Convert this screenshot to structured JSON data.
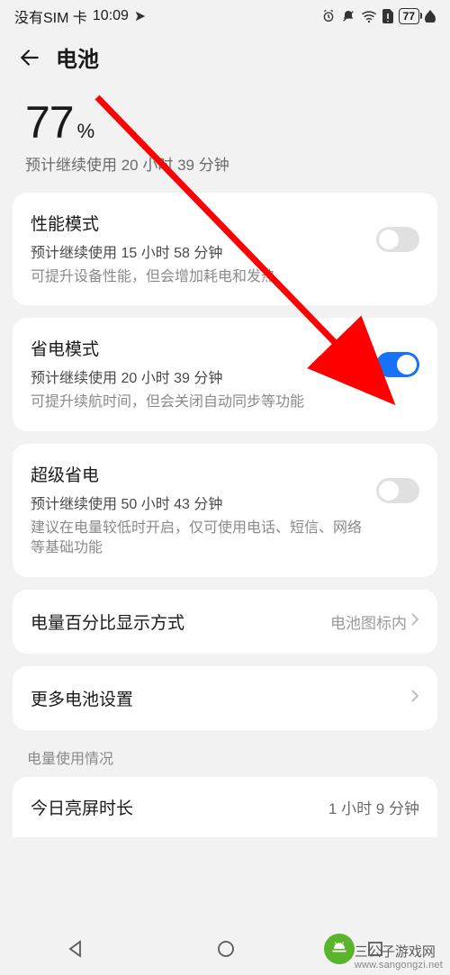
{
  "status_bar": {
    "sim": "没有SIM 卡",
    "time": "10:09",
    "battery": "77"
  },
  "header": {
    "title": "电池"
  },
  "battery": {
    "percent": "77",
    "percent_symbol": "%",
    "estimate": "预计继续使用 20 小时 39 分钟"
  },
  "modes": {
    "performance": {
      "title": "性能模式",
      "sub": "预计继续使用 15 小时 58 分钟",
      "desc": "可提升设备性能，但会增加耗电和发热",
      "on": false
    },
    "power_save": {
      "title": "省电模式",
      "sub": "预计继续使用 20 小时 39 分钟",
      "desc": "可提升续航时间，但会关闭自动同步等功能",
      "on": true
    },
    "super_save": {
      "title": "超级省电",
      "sub": "预计继续使用 50 小时 43 分钟",
      "desc": "建议在电量较低时开启，仅可使用电话、短信、网络等基础功能",
      "on": false
    }
  },
  "links": {
    "percent_display": {
      "title": "电量百分比显示方式",
      "value": "电池图标内"
    },
    "more_settings": {
      "title": "更多电池设置"
    }
  },
  "usage": {
    "section_label": "电量使用情况",
    "screen_on": {
      "title": "今日亮屏时长",
      "value": "1 小时 9 分钟"
    }
  },
  "watermark": {
    "name": "三公子游戏网",
    "url": "www.sangongzi.net"
  }
}
